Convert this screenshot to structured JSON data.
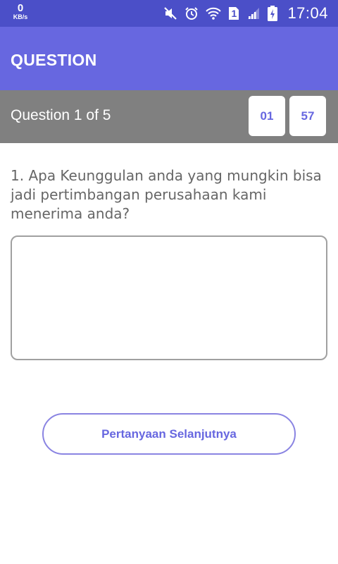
{
  "status_bar": {
    "net_speed_value": "0",
    "net_speed_unit": "KB/s",
    "icons": [
      "mute-icon",
      "alarm-icon",
      "wifi-icon",
      "sim-1-icon",
      "signal-icon",
      "battery-charging-icon"
    ],
    "sim_label": "1",
    "time": "17:04"
  },
  "app_bar": {
    "title": "QUESTION"
  },
  "question_header": {
    "counter": "Question 1 of 5",
    "timer_minutes": "01",
    "timer_seconds": "57"
  },
  "question": {
    "text": "1. Apa Keunggulan anda yang mungkin bisa jadi pertimbangan perusahaan kami menerima anda?",
    "answer_value": "",
    "answer_placeholder": ""
  },
  "actions": {
    "next_label": "Pertanyaan Selanjutnya"
  },
  "colors": {
    "status_bar": "#4b4fc8",
    "app_bar": "#6767e0",
    "header_gray": "#808080",
    "accent": "#6767e0"
  }
}
